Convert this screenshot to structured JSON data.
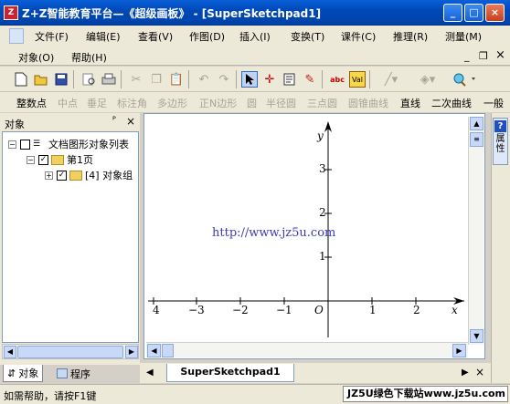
{
  "window": {
    "title": "Z+Z智能教育平台—《超级画板》 - [SuperSketchpad1]",
    "app_icon": "Z",
    "controls": {
      "minimize": "_",
      "maximize": "□",
      "close": "×"
    },
    "colors": {
      "titlebar": "#0a5fd8",
      "close": "#c8401c"
    }
  },
  "menu": {
    "row1": [
      "文件(F)",
      "编辑(E)",
      "查看(V)",
      "作图(D)",
      "插入(I)",
      "变换(T)",
      "课件(C)",
      "推理(R)",
      "测量(M)"
    ],
    "row2": [
      "对象(O)",
      "帮助(H)"
    ],
    "mdi_controls": {
      "minimize": "_",
      "restore": "❐",
      "close": "×"
    }
  },
  "toolbar1": {
    "icons": [
      "new-icon",
      "open-icon",
      "save-icon",
      "print-preview-icon",
      "print-icon",
      "cut-icon",
      "copy-icon",
      "paste-icon",
      "undo-icon",
      "redo-icon",
      "select-arrow-icon",
      "point-tool-icon",
      "text-tool-icon",
      "pen-tool-icon",
      "abc-icon",
      "value-icon",
      "line-color-icon",
      "fill-color-icon",
      "zoom-icon"
    ]
  },
  "toolbar2": {
    "items": [
      {
        "label": "整数点",
        "enabled": true
      },
      {
        "label": "中点",
        "enabled": false
      },
      {
        "label": "垂足",
        "enabled": false
      },
      {
        "label": "标注角",
        "enabled": false
      },
      {
        "label": "多边形",
        "enabled": false
      },
      {
        "label": "正N边形",
        "enabled": false
      },
      {
        "label": "圆",
        "enabled": false
      },
      {
        "label": "半径圆",
        "enabled": false
      },
      {
        "label": "三点圆",
        "enabled": false
      },
      {
        "label": "圆锥曲线",
        "enabled": false
      },
      {
        "label": "直线",
        "enabled": true
      },
      {
        "label": "二次曲线",
        "enabled": true
      },
      {
        "label": "一般",
        "enabled": true
      }
    ]
  },
  "object_panel": {
    "title": "对象",
    "pin": "ᴾ",
    "close": "×",
    "tree": [
      {
        "label": "文档图形对象列表",
        "level": 0,
        "expander": "−"
      },
      {
        "label": "第1页",
        "level": 1,
        "expander": "−"
      },
      {
        "label": "[4] 对象组",
        "level": 2,
        "expander": "+"
      }
    ],
    "tabs": [
      {
        "label": "对象",
        "icon": "tree-icon",
        "active": true
      },
      {
        "label": "程序",
        "icon": "program-icon",
        "active": false
      }
    ]
  },
  "canvas": {
    "watermark": "http://www.jz5u.com",
    "x_axis_label": "x",
    "y_axis_label": "y",
    "origin_label": "O",
    "x_ticks": [
      "4",
      "−3",
      "−2",
      "−1",
      "1",
      "2"
    ],
    "y_ticks": [
      "3",
      "2",
      "1"
    ]
  },
  "doc_tab": {
    "label": "SuperSketchpad1",
    "nav_left": "◀",
    "nav_right": "▶",
    "close": "×"
  },
  "right_strip": {
    "help": "?",
    "prop_label": "属性"
  },
  "status": {
    "text": "如需帮助，请按F1键",
    "badge": "JZ5U绿色下载站www.jz5u.com"
  }
}
